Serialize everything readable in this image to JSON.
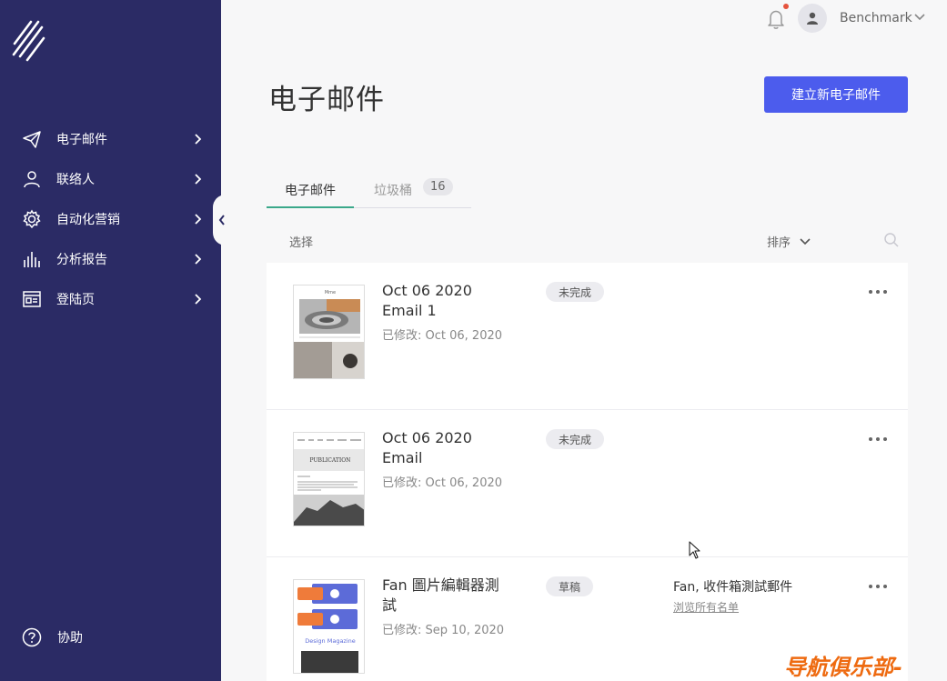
{
  "sidebar": {
    "items": [
      {
        "label": "电子邮件",
        "icon": "paper-plane-icon"
      },
      {
        "label": "联络人",
        "icon": "user-icon"
      },
      {
        "label": "自动化营销",
        "icon": "gear-icon"
      },
      {
        "label": "分析报告",
        "icon": "bar-chart-icon"
      },
      {
        "label": "登陆页",
        "icon": "layout-icon"
      }
    ],
    "help_label": "协助"
  },
  "topbar": {
    "user_name": "Benchmark"
  },
  "header": {
    "title": "电子邮件",
    "create_button": "建立新电子邮件"
  },
  "tabs": {
    "emails": "电子邮件",
    "trash": "垃圾桶",
    "trash_count": "16"
  },
  "toolbar": {
    "select_label": "选择",
    "sort_label": "排序"
  },
  "emails": [
    {
      "title": "Oct 06 2020 Email 1",
      "modified": "已修改: Oct 06, 2020",
      "status": "未完成"
    },
    {
      "title": "Oct 06 2020 Email",
      "modified": "已修改: Oct 06, 2020",
      "status": "未完成",
      "thumb_text": "PUBLICATION"
    },
    {
      "title": "Fan 圖片編輯器測試",
      "modified": "已修改: Sep 10, 2020",
      "status": "草稿",
      "list_name": "Fan, 收件箱測試郵件",
      "list_link": "浏览所有名单",
      "thumb_text": "Design Magazine"
    }
  ],
  "watermark": "导航俱乐部-",
  "colors": {
    "sidebar_bg": "#2b2b65",
    "primary_button": "#4c5ced",
    "tab_underline": "#3aa88a",
    "notification_dot": "#e5533d"
  }
}
